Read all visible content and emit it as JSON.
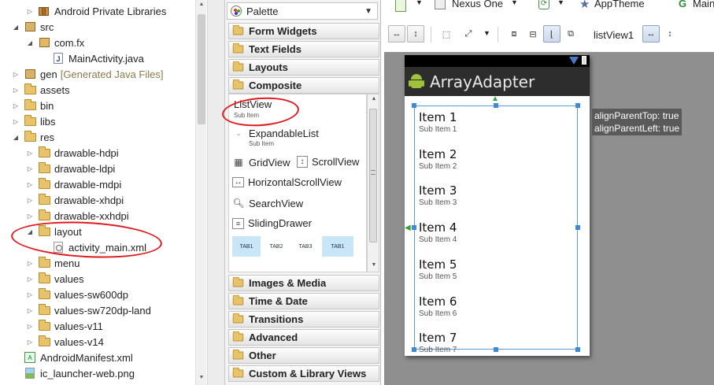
{
  "explorer": {
    "rows": [
      {
        "label": "Android Private Libraries",
        "indent": 1,
        "icon": "libs-icon"
      },
      {
        "label": "src",
        "indent": 0,
        "icon": "source-folder-icon",
        "expanded": true
      },
      {
        "label": "com.fx",
        "indent": 1,
        "icon": "package-icon",
        "expanded": true
      },
      {
        "label": "MainActivity.java",
        "indent": 2,
        "icon": "java-file-icon"
      },
      {
        "label": "gen",
        "suffix": "[Generated Java Files]",
        "indent": 0,
        "icon": "source-folder-icon"
      },
      {
        "label": "assets",
        "indent": 0,
        "icon": "folder-icon"
      },
      {
        "label": "bin",
        "indent": 0,
        "icon": "folder-icon"
      },
      {
        "label": "libs",
        "indent": 0,
        "icon": "folder-icon"
      },
      {
        "label": "res",
        "indent": 0,
        "icon": "folder-icon",
        "expanded": true
      },
      {
        "label": "drawable-hdpi",
        "indent": 1,
        "icon": "folder-icon"
      },
      {
        "label": "drawable-ldpi",
        "indent": 1,
        "icon": "folder-icon"
      },
      {
        "label": "drawable-mdpi",
        "indent": 1,
        "icon": "folder-icon"
      },
      {
        "label": "drawable-xhdpi",
        "indent": 1,
        "icon": "folder-icon"
      },
      {
        "label": "drawable-xxhdpi",
        "indent": 1,
        "icon": "folder-icon"
      },
      {
        "label": "layout",
        "indent": 1,
        "icon": "folder-icon",
        "expanded": true
      },
      {
        "label": "activity_main.xml",
        "indent": 2,
        "icon": "xml-file-icon"
      },
      {
        "label": "menu",
        "indent": 1,
        "icon": "folder-icon"
      },
      {
        "label": "values",
        "indent": 1,
        "icon": "folder-icon"
      },
      {
        "label": "values-sw600dp",
        "indent": 1,
        "icon": "folder-icon"
      },
      {
        "label": "values-sw720dp-land",
        "indent": 1,
        "icon": "folder-icon"
      },
      {
        "label": "values-v11",
        "indent": 1,
        "icon": "folder-icon"
      },
      {
        "label": "values-v14",
        "indent": 1,
        "icon": "folder-icon"
      },
      {
        "label": "AndroidManifest.xml",
        "indent": 0,
        "icon": "manifest-icon"
      },
      {
        "label": "ic_launcher-web.png",
        "indent": 0,
        "icon": "png-file-icon"
      }
    ]
  },
  "palette": {
    "title": "Palette",
    "categories_top": [
      "Form Widgets",
      "Text Fields",
      "Layouts",
      "Composite"
    ],
    "widgets": {
      "listview": {
        "label": "ListView",
        "sub": "Sub Item"
      },
      "expandable": {
        "label": "ExpandableList",
        "sub": "Sub Item"
      },
      "gridview": "GridView",
      "scrollview": "ScrollView",
      "hscroll": "HorizontalScrollView",
      "search": "SearchView",
      "drawer": "SlidingDrawer",
      "tabs": [
        "TAB1",
        "TAB2",
        "TAB3",
        "TAB1"
      ]
    },
    "categories_bottom": [
      "Images & Media",
      "Time & Date",
      "Transitions",
      "Advanced",
      "Other",
      "Custom & Library Views"
    ]
  },
  "toolbar": {
    "device": "Nexus One",
    "theme": "AppTheme",
    "activity": "Main",
    "selected_view": "listView1"
  },
  "preview": {
    "app_title": "ArrayAdapter",
    "items": [
      {
        "title": "Item 1",
        "sub": "Sub Item 1"
      },
      {
        "title": "Item 2",
        "sub": "Sub Item 2"
      },
      {
        "title": "Item 3",
        "sub": "Sub Item 3"
      },
      {
        "title": "Item 4",
        "sub": "Sub Item 4"
      },
      {
        "title": "Item 5",
        "sub": "Sub Item 5"
      },
      {
        "title": "Item 6",
        "sub": "Sub Item 6"
      },
      {
        "title": "Item 7",
        "sub": "Sub Item 7"
      }
    ],
    "tooltip": [
      "alignParentTop: true",
      "alignParentLeft: true"
    ]
  },
  "colors": {
    "annotation_red": "#e0191e",
    "selection_blue": "#3d8ad6",
    "action_bar": "#2d2d2d",
    "canvas_gray": "#8f8f8f"
  }
}
